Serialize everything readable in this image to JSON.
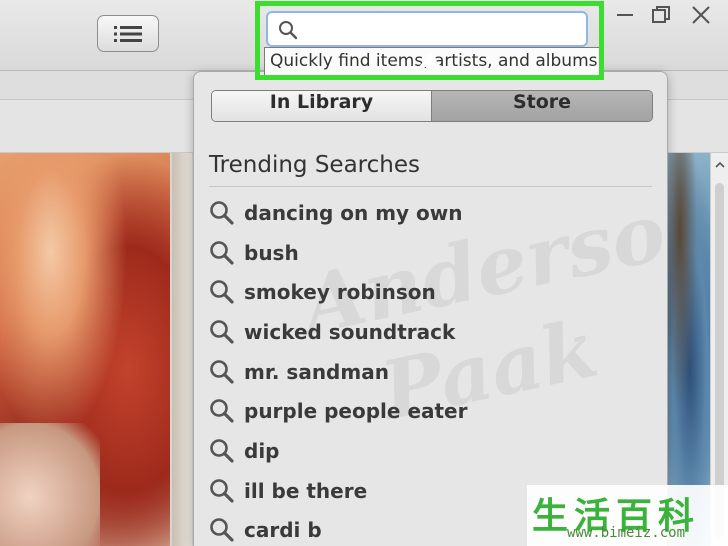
{
  "search": {
    "value": "",
    "placeholder": "",
    "tooltip": "Quickly find items, artists, and albums."
  },
  "popover": {
    "tabs": {
      "in_library": "In Library",
      "store": "Store",
      "selected": "Store"
    },
    "trending_title": "Trending Searches",
    "trending": [
      "dancing on my own",
      "bush",
      "smokey robinson",
      "wicked soundtrack",
      "mr. sandman",
      "purple people eater",
      "dip",
      "ill be there",
      "cardi b"
    ]
  },
  "background_art": {
    "text_lines": [
      "Anderson",
      "Paak"
    ]
  },
  "watermark": {
    "chinese": "生活百科",
    "url": "www.bimeiz.com"
  },
  "icons": {
    "list_view": "list-icon",
    "search": "search-icon",
    "minimize": "minimize-icon",
    "restore": "restore-icon",
    "close": "close-icon"
  },
  "colors": {
    "highlight": "#3ddc31",
    "segment_selected": "#ababab"
  }
}
